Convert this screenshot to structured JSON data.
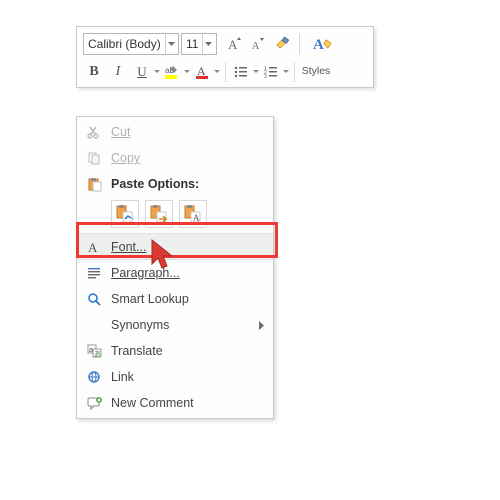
{
  "toolbar": {
    "font_name": "Calibri (Body)",
    "font_size": "11",
    "styles_label": "Styles"
  },
  "menu": {
    "cut": "Cut",
    "copy": "Copy",
    "paste_header": "Paste Options:",
    "font": "Font...",
    "paragraph": "Paragraph...",
    "smart_lookup": "Smart Lookup",
    "synonyms": "Synonyms",
    "translate": "Translate",
    "link": "Link",
    "new_comment": "New Comment"
  }
}
